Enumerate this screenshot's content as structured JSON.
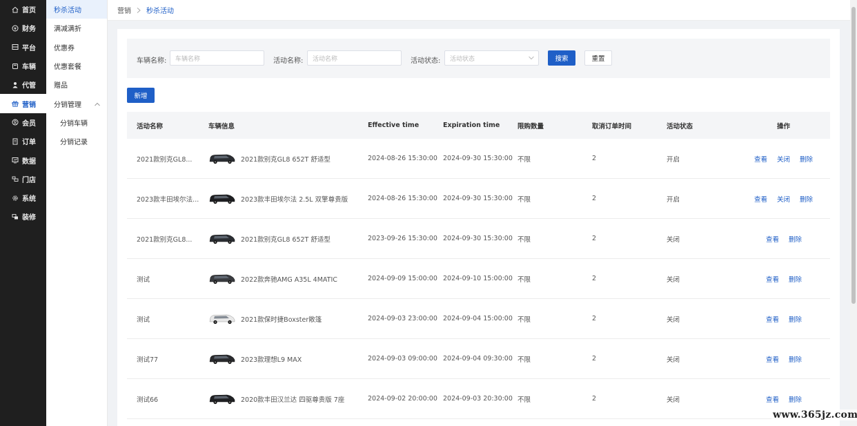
{
  "nav": {
    "items": [
      {
        "label": "首页",
        "icon": "home-icon"
      },
      {
        "label": "财务",
        "icon": "finance-icon"
      },
      {
        "label": "平台",
        "icon": "platform-icon"
      },
      {
        "label": "车辆",
        "icon": "vehicle-icon"
      },
      {
        "label": "代管",
        "icon": "agent-icon"
      },
      {
        "label": "营销",
        "icon": "gift-icon"
      },
      {
        "label": "会员",
        "icon": "member-icon"
      },
      {
        "label": "订单",
        "icon": "order-icon"
      },
      {
        "label": "数据",
        "icon": "data-icon"
      },
      {
        "label": "门店",
        "icon": "store-icon"
      },
      {
        "label": "系统",
        "icon": "system-icon"
      },
      {
        "label": "装修",
        "icon": "decorate-icon"
      }
    ],
    "active_index": 5
  },
  "subnav": {
    "items": [
      "秒杀活动",
      "满减满折",
      "优惠券",
      "优惠套餐",
      "赠品",
      "分销管理"
    ],
    "children": [
      "分销车辆",
      "分销记录"
    ]
  },
  "breadcrumb": {
    "parent": "营销",
    "current": "秒杀活动"
  },
  "filter": {
    "vehicle_label": "车辆名称:",
    "vehicle_placeholder": "车辆名称",
    "activity_label": "活动名称:",
    "activity_placeholder": "活动名称",
    "status_label": "活动状态:",
    "status_placeholder": "活动状态",
    "search_label": "搜索",
    "reset_label": "重置"
  },
  "add_label": "新增",
  "table": {
    "headers": [
      "活动名称",
      "车辆信息",
      "Effective time",
      "Expiration time",
      "限购数量",
      "取消订单时间",
      "活动状态",
      "操作"
    ],
    "actions": {
      "view": "查看",
      "close": "关闭",
      "delete": "删除"
    },
    "rows": [
      {
        "name": "2021款别克GL8...",
        "vehicle": "2021款别克GL8 652T 舒适型",
        "start": "2024-08-26 15:30:00",
        "end": "2024-09-30 15:30:00",
        "limit": "不限",
        "cancel": "2",
        "status": "开启",
        "car_color": "#2b2e33"
      },
      {
        "name": "2023款丰田埃尔法...",
        "vehicle": "2023款丰田埃尔法 2.5L 双擎尊贵版",
        "start": "2024-08-26 15:30:00",
        "end": "2024-09-30 15:30:00",
        "limit": "不限",
        "cancel": "2",
        "status": "开启",
        "car_color": "#1e1f22"
      },
      {
        "name": "2021款别克GL8...",
        "vehicle": "2021款别克GL8 652T 舒适型",
        "start": "2023-09-26 15:30:00",
        "end": "2024-09-30 15:30:00",
        "limit": "不限",
        "cancel": "2",
        "status": "关闭",
        "car_color": "#2b2e33"
      },
      {
        "name": "测试",
        "vehicle": "2022款奔驰AMG A35L 4MATIC",
        "start": "2024-09-09 15:00:00",
        "end": "2024-09-10 15:00:00",
        "limit": "不限",
        "cancel": "2",
        "status": "关闭",
        "car_color": "#3a3c40"
      },
      {
        "name": "测试",
        "vehicle": "2021款保时捷Boxster敞篷",
        "start": "2024-09-03 23:00:00",
        "end": "2024-09-04 15:00:00",
        "limit": "不限",
        "cancel": "2",
        "status": "关闭",
        "car_color": "#e8e8e8"
      },
      {
        "name": "测试77",
        "vehicle": "2023款理想L9 MAX",
        "start": "2024-09-03 09:00:00",
        "end": "2024-09-04 09:30:00",
        "limit": "不限",
        "cancel": "2",
        "status": "关闭",
        "car_color": "#2a2b2e"
      },
      {
        "name": "测试66",
        "vehicle": "2020款丰田汉兰达 四驱尊贵版 7座",
        "start": "2024-09-02 20:00:00",
        "end": "2024-09-03 20:30:00",
        "limit": "不限",
        "cancel": "2",
        "status": "关闭",
        "car_color": "#202124"
      }
    ]
  },
  "watermark": "www.365jz.com"
}
